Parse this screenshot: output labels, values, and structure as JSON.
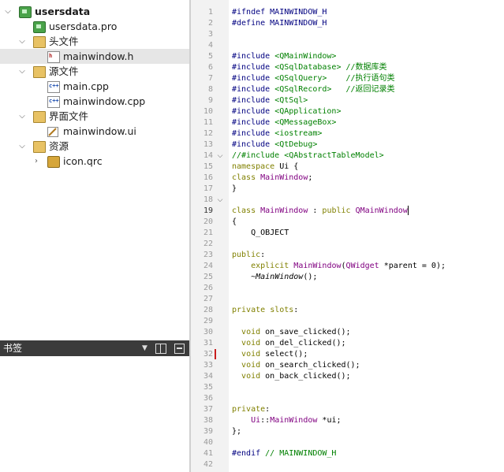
{
  "project_tree": {
    "items": [
      {
        "label": "usersdata",
        "icon": "qt-project-icon",
        "expanded": true
      },
      {
        "label": "usersdata.pro",
        "icon": "pro-file-icon"
      },
      {
        "label": "头文件",
        "icon": "headers-folder-icon",
        "expanded": true
      },
      {
        "label": "mainwindow.h",
        "icon": "header-file-icon",
        "selected": true
      },
      {
        "label": "源文件",
        "icon": "sources-folder-icon",
        "expanded": true
      },
      {
        "label": "main.cpp",
        "icon": "cpp-file-icon"
      },
      {
        "label": "mainwindow.cpp",
        "icon": "cpp-file-icon"
      },
      {
        "label": "界面文件",
        "icon": "forms-folder-icon",
        "expanded": true
      },
      {
        "label": "mainwindow.ui",
        "icon": "ui-file-icon"
      },
      {
        "label": "资源",
        "icon": "resources-folder-icon",
        "expanded": true
      },
      {
        "label": "icon.qrc",
        "icon": "qrc-file-icon",
        "expanded": false
      }
    ]
  },
  "bookmarks": {
    "title": "书签"
  },
  "editor": {
    "current_line": 19,
    "marked_line": 32,
    "folded_lines": [
      14,
      18
    ],
    "lines": [
      {
        "n": "1",
        "segs": [
          {
            "t": "#ifndef MAINWINDOW_H",
            "c": "pp"
          }
        ]
      },
      {
        "n": "2",
        "segs": [
          {
            "t": "#define MAINWINDOW_H",
            "c": "pp"
          }
        ]
      },
      {
        "n": "3",
        "segs": []
      },
      {
        "n": "4",
        "segs": []
      },
      {
        "n": "5",
        "segs": [
          {
            "t": "#include ",
            "c": "pp"
          },
          {
            "t": "<QMainWindow>",
            "c": "st"
          }
        ]
      },
      {
        "n": "6",
        "segs": [
          {
            "t": "#include ",
            "c": "pp"
          },
          {
            "t": "<QSqlDatabase>",
            "c": "st"
          },
          {
            "t": " //数据库类",
            "c": "cm"
          }
        ]
      },
      {
        "n": "7",
        "segs": [
          {
            "t": "#include ",
            "c": "pp"
          },
          {
            "t": "<QSqlQuery>",
            "c": "st"
          },
          {
            "t": "    //执行语句类",
            "c": "cm"
          }
        ]
      },
      {
        "n": "8",
        "segs": [
          {
            "t": "#include ",
            "c": "pp"
          },
          {
            "t": "<QSqlRecord>",
            "c": "st"
          },
          {
            "t": "   //返回记录类",
            "c": "cm"
          }
        ]
      },
      {
        "n": "9",
        "segs": [
          {
            "t": "#include ",
            "c": "pp"
          },
          {
            "t": "<QtSql>",
            "c": "st"
          }
        ]
      },
      {
        "n": "10",
        "segs": [
          {
            "t": "#include ",
            "c": "pp"
          },
          {
            "t": "<QApplication>",
            "c": "st"
          }
        ]
      },
      {
        "n": "11",
        "segs": [
          {
            "t": "#include ",
            "c": "pp"
          },
          {
            "t": "<QMessageBox>",
            "c": "st"
          }
        ]
      },
      {
        "n": "12",
        "segs": [
          {
            "t": "#include ",
            "c": "pp"
          },
          {
            "t": "<iostream>",
            "c": "st"
          }
        ]
      },
      {
        "n": "13",
        "segs": [
          {
            "t": "#include ",
            "c": "pp"
          },
          {
            "t": "<QtDebug>",
            "c": "st"
          }
        ]
      },
      {
        "n": "14",
        "segs": [
          {
            "t": "//#include <QAbstractTableModel>",
            "c": "cm"
          }
        ]
      },
      {
        "n": "15",
        "segs": [
          {
            "t": "namespace",
            "c": "kw"
          },
          {
            "t": " Ui {",
            "c": ""
          }
        ]
      },
      {
        "n": "16",
        "segs": [
          {
            "t": "class",
            "c": "kw"
          },
          {
            "t": " ",
            "c": ""
          },
          {
            "t": "MainWindow",
            "c": "ty"
          },
          {
            "t": ";",
            "c": ""
          }
        ]
      },
      {
        "n": "17",
        "segs": [
          {
            "t": "}",
            "c": ""
          }
        ]
      },
      {
        "n": "18",
        "segs": []
      },
      {
        "n": "19",
        "segs": [
          {
            "t": "class",
            "c": "kw"
          },
          {
            "t": " ",
            "c": ""
          },
          {
            "t": "MainWindow",
            "c": "ty"
          },
          {
            "t": " : ",
            "c": ""
          },
          {
            "t": "public",
            "c": "kw"
          },
          {
            "t": " ",
            "c": ""
          },
          {
            "t": "QMainWindow",
            "c": "ty"
          }
        ]
      },
      {
        "n": "20",
        "segs": [
          {
            "t": "{",
            "c": ""
          }
        ]
      },
      {
        "n": "21",
        "segs": [
          {
            "t": "    Q_OBJECT",
            "c": ""
          }
        ]
      },
      {
        "n": "22",
        "segs": []
      },
      {
        "n": "23",
        "segs": [
          {
            "t": "public",
            "c": "kw"
          },
          {
            "t": ":",
            "c": ""
          }
        ]
      },
      {
        "n": "24",
        "segs": [
          {
            "t": "    ",
            "c": ""
          },
          {
            "t": "explicit",
            "c": "kw"
          },
          {
            "t": " ",
            "c": ""
          },
          {
            "t": "MainWindow",
            "c": "ty"
          },
          {
            "t": "(",
            "c": ""
          },
          {
            "t": "QWidget",
            "c": "ty"
          },
          {
            "t": " *parent = 0);",
            "c": ""
          }
        ]
      },
      {
        "n": "25",
        "segs": [
          {
            "t": "    ~",
            "c": ""
          },
          {
            "t": "MainWindow",
            "c": "it"
          },
          {
            "t": "();",
            "c": ""
          }
        ]
      },
      {
        "n": "26",
        "segs": []
      },
      {
        "n": "27",
        "segs": []
      },
      {
        "n": "28",
        "segs": [
          {
            "t": "private",
            "c": "kw"
          },
          {
            "t": " ",
            "c": ""
          },
          {
            "t": "slots",
            "c": "kw"
          },
          {
            "t": ":",
            "c": ""
          }
        ]
      },
      {
        "n": "29",
        "segs": []
      },
      {
        "n": "30",
        "segs": [
          {
            "t": "  ",
            "c": ""
          },
          {
            "t": "void",
            "c": "kw"
          },
          {
            "t": " on_save_clicked();",
            "c": ""
          }
        ]
      },
      {
        "n": "31",
        "segs": [
          {
            "t": "  ",
            "c": ""
          },
          {
            "t": "void",
            "c": "kw"
          },
          {
            "t": " on_del_clicked();",
            "c": ""
          }
        ]
      },
      {
        "n": "32",
        "segs": [
          {
            "t": "  ",
            "c": ""
          },
          {
            "t": "void",
            "c": "kw"
          },
          {
            "t": " select();",
            "c": ""
          }
        ]
      },
      {
        "n": "33",
        "segs": [
          {
            "t": "  ",
            "c": ""
          },
          {
            "t": "void",
            "c": "kw"
          },
          {
            "t": " on_search_clicked();",
            "c": ""
          }
        ]
      },
      {
        "n": "34",
        "segs": [
          {
            "t": "  ",
            "c": ""
          },
          {
            "t": "void",
            "c": "kw"
          },
          {
            "t": " on_back_clicked();",
            "c": ""
          }
        ]
      },
      {
        "n": "35",
        "segs": []
      },
      {
        "n": "36",
        "segs": []
      },
      {
        "n": "37",
        "segs": [
          {
            "t": "private",
            "c": "kw"
          },
          {
            "t": ":",
            "c": ""
          }
        ]
      },
      {
        "n": "38",
        "segs": [
          {
            "t": "    ",
            "c": ""
          },
          {
            "t": "Ui",
            "c": "ty"
          },
          {
            "t": "::",
            "c": ""
          },
          {
            "t": "MainWindow",
            "c": "ty"
          },
          {
            "t": " *ui;",
            "c": ""
          }
        ]
      },
      {
        "n": "39",
        "segs": [
          {
            "t": "};",
            "c": ""
          }
        ]
      },
      {
        "n": "40",
        "segs": []
      },
      {
        "n": "41",
        "segs": [
          {
            "t": "#endif",
            "c": "pp"
          },
          {
            "t": " // MAINWINDOW_H",
            "c": "cm"
          }
        ]
      },
      {
        "n": "42",
        "segs": []
      }
    ]
  }
}
